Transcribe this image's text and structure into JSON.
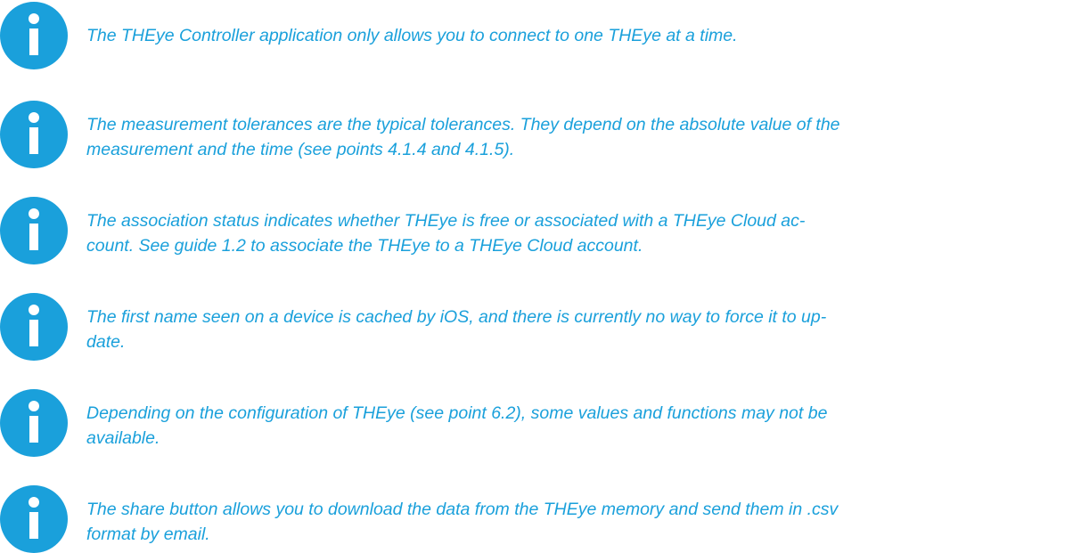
{
  "colors": {
    "accent": "#1aa0db",
    "icon": "#1aa0db"
  },
  "icon_name": "info-icon",
  "notes": [
    {
      "lines": [
        "The THEye Controller application only allows you to connect to one THEye at a time."
      ]
    },
    {
      "lines": [
        "The measurement tolerances are the typical tolerances. They depend on the absolute value of the",
        "measurement and the time (see points 4.1.4 and 4.1.5)."
      ]
    },
    {
      "lines": [
        "The association status indicates whether THEye is free or associated with a THEye Cloud ac-",
        "count. See guide 1.2 to associate the THEye to a THEye Cloud account."
      ]
    },
    {
      "lines": [
        "The first name seen on a device is cached by iOS, and there is currently no way to force it to up-",
        "date."
      ]
    },
    {
      "lines": [
        "Depending on the configuration of THEye (see point 6.2), some values and functions may not be",
        "available."
      ]
    },
    {
      "lines": [
        "The share button allows you to download the data from the THEye memory and send them in .csv",
        "format by email."
      ]
    }
  ]
}
